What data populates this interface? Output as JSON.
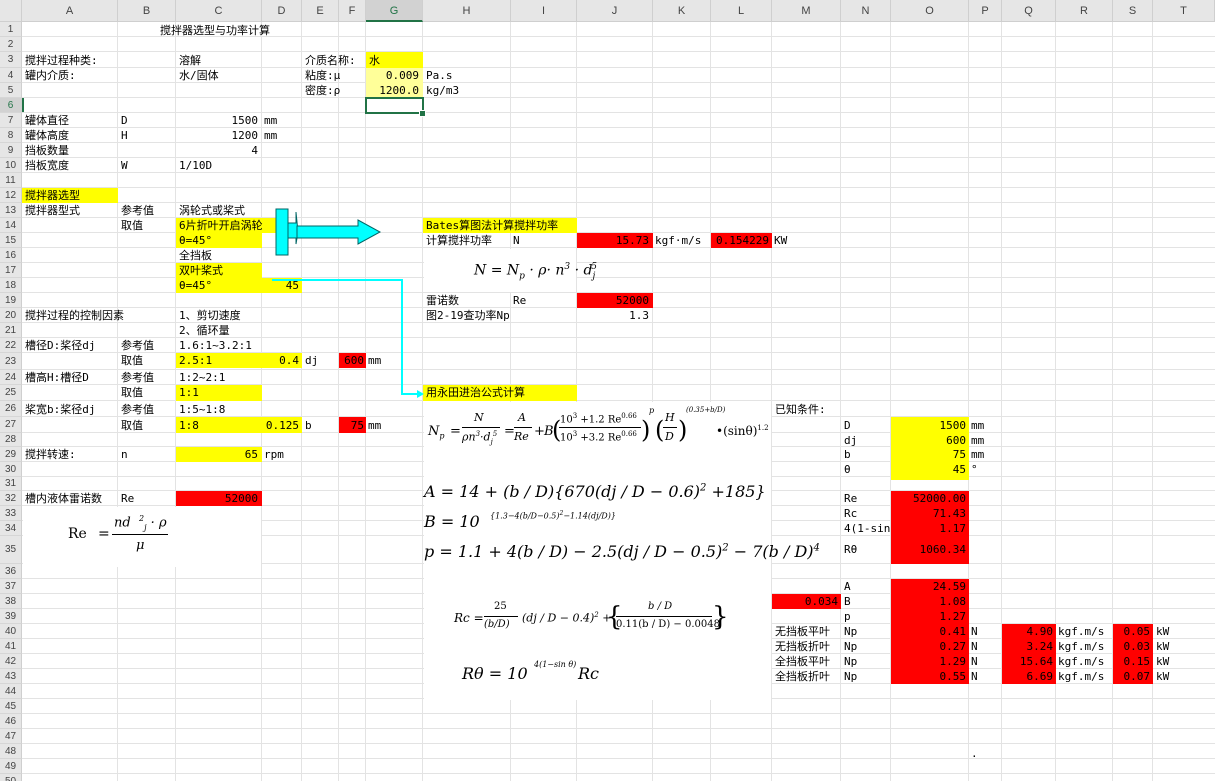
{
  "columns": [
    "A",
    "B",
    "C",
    "D",
    "E",
    "F",
    "G",
    "H",
    "I",
    "J",
    "K",
    "L",
    "M",
    "N",
    "O",
    "P",
    "Q",
    "R",
    "S",
    "T"
  ],
  "rows": [
    "1",
    "2",
    "3",
    "4",
    "5",
    "6",
    "7",
    "8",
    "9",
    "10",
    "11",
    "12",
    "13",
    "14",
    "15",
    "16",
    "17",
    "18",
    "19",
    "20",
    "21",
    "22",
    "23",
    "24",
    "25",
    "26",
    "27",
    "28",
    "29",
    "30",
    "31",
    "32",
    "33",
    "34",
    "35",
    "36",
    "37",
    "38",
    "39",
    "40",
    "41",
    "42",
    "43",
    "44",
    "45",
    "46",
    "47",
    "48",
    "49",
    "50"
  ],
  "selected_cell": "G6",
  "title": "搅拌器选型与功率计算",
  "medium": {
    "process_label": "搅拌过程种类:",
    "process_value": "溶解",
    "tank_medium_label": "罐内介质:",
    "tank_medium_value": "水/固体",
    "medium_name_label": "介质名称:",
    "medium_name_value": "水",
    "viscosity_label": "粘度:μ",
    "viscosity_value": "0.009",
    "viscosity_unit": "Pa.s",
    "density_label": "密度:ρ",
    "density_value": "1200.0",
    "density_unit": "kg/m3"
  },
  "tank": {
    "diameter_label": "罐体直径",
    "diameter_sym": "D",
    "diameter_value": "1500",
    "diameter_unit": "mm",
    "height_label": "罐体高度",
    "height_sym": "H",
    "height_value": "1200",
    "height_unit": "mm",
    "baffle_count_label": "挡板数量",
    "baffle_count_value": "4",
    "baffle_width_label": "挡板宽度",
    "baffle_width_sym": "W",
    "baffle_width_value": "1/10D"
  },
  "selection": {
    "section_label": "搅拌器选型",
    "type_label": "搅拌器型式",
    "ref_label": "参考值",
    "ref_value": "涡轮式或桨式",
    "take_label": "取值",
    "take_value": "6片折叶开启涡轮",
    "angle1": "θ=45°",
    "full_baffle": "全挡板",
    "double_blade": "双叶桨式",
    "angle2": "θ=45°",
    "angle2_value": "45"
  },
  "control": {
    "label": "搅拌过程的控制因素",
    "factor1": "1、剪切速度",
    "factor2": "2、循环量",
    "dj_label": "槽径D:桨径dj",
    "dj_ref_label": "参考值",
    "dj_ref_value": "1.6:1~3.2:1",
    "dj_take_label": "取值",
    "dj_take_value": "2.5:1",
    "dj_ratio": "0.4",
    "dj_sym": "dj",
    "dj_result": "600",
    "dj_unit": "mm",
    "h_label": "槽高H:槽径D",
    "h_ref_label": "参考值",
    "h_ref_value": "1:2~2:1",
    "h_take_label": "取值",
    "h_take_value": "1:1",
    "b_label": "桨宽b:桨径dj",
    "b_ref_label": "参考值",
    "b_ref_value": "1:5~1:8",
    "b_take_label": "取值",
    "b_take_value": "1:8",
    "b_ratio": "0.125",
    "b_sym": "b",
    "b_result": "75",
    "b_unit": "mm",
    "speed_label": "搅拌转速:",
    "speed_sym": "n",
    "speed_value": "65",
    "speed_unit": "rpm",
    "re_label": "槽内液体雷诺数",
    "re_sym": "Re",
    "re_value": "52000"
  },
  "bates": {
    "title": "Bates算图法计算搅拌功率",
    "power_label": "计算搅拌功率",
    "power_sym": "N",
    "power_value": "15.73",
    "power_unit": "kgf·m/s",
    "power_kw": "0.154229",
    "power_kw_unit": "KW",
    "re_label": "雷诺数",
    "re_sym": "Re",
    "re_value": "52000",
    "np_label": "图2-19查功率Np",
    "np_value": "1.3"
  },
  "nagata": {
    "title": "用永田进治公式计算",
    "known_label": "已知条件:",
    "known": [
      {
        "sym": "D",
        "value": "1500",
        "unit": "mm"
      },
      {
        "sym": "dj",
        "value": "600",
        "unit": "mm"
      },
      {
        "sym": "b",
        "value": "75",
        "unit": "mm"
      },
      {
        "sym": "θ",
        "value": "45",
        "unit": "°"
      }
    ],
    "calc": [
      {
        "sym": "Re",
        "value": "52000.00"
      },
      {
        "sym": "Rc",
        "value": "71.43"
      },
      {
        "sym": "4(1-sin",
        "value": "1.17"
      },
      {
        "sym": "Rθ",
        "value": "1060.34"
      }
    ],
    "coef": [
      {
        "sym": "A",
        "value": "24.59"
      },
      {
        "sym": "B",
        "value": "1.08"
      },
      {
        "sym": "p",
        "value": "1.27"
      }
    ],
    "m38_value": "0.034",
    "results": [
      {
        "label": "无挡板平叶",
        "sym": "Np",
        "np": "0.41",
        "n": "N",
        "power": "4.90",
        "unit": "kgf.m/s",
        "kw": "0.05",
        "kw_unit": "kW"
      },
      {
        "label": "无挡板折叶",
        "sym": "Np",
        "np": "0.27",
        "n": "N",
        "power": "3.24",
        "unit": "kgf.m/s",
        "kw": "0.03",
        "kw_unit": "kW"
      },
      {
        "label": "全挡板平叶",
        "sym": "Np",
        "np": "1.29",
        "n": "N",
        "power": "15.64",
        "unit": "kgf.m/s",
        "kw": "0.15",
        "kw_unit": "kW"
      },
      {
        "label": "全挡板折叶",
        "sym": "Np",
        "np": "0.55",
        "n": "N",
        "power": "6.69",
        "unit": "kgf.m/s",
        "kw": "0.07",
        "kw_unit": "kW"
      }
    ]
  },
  "stray_dot": "."
}
